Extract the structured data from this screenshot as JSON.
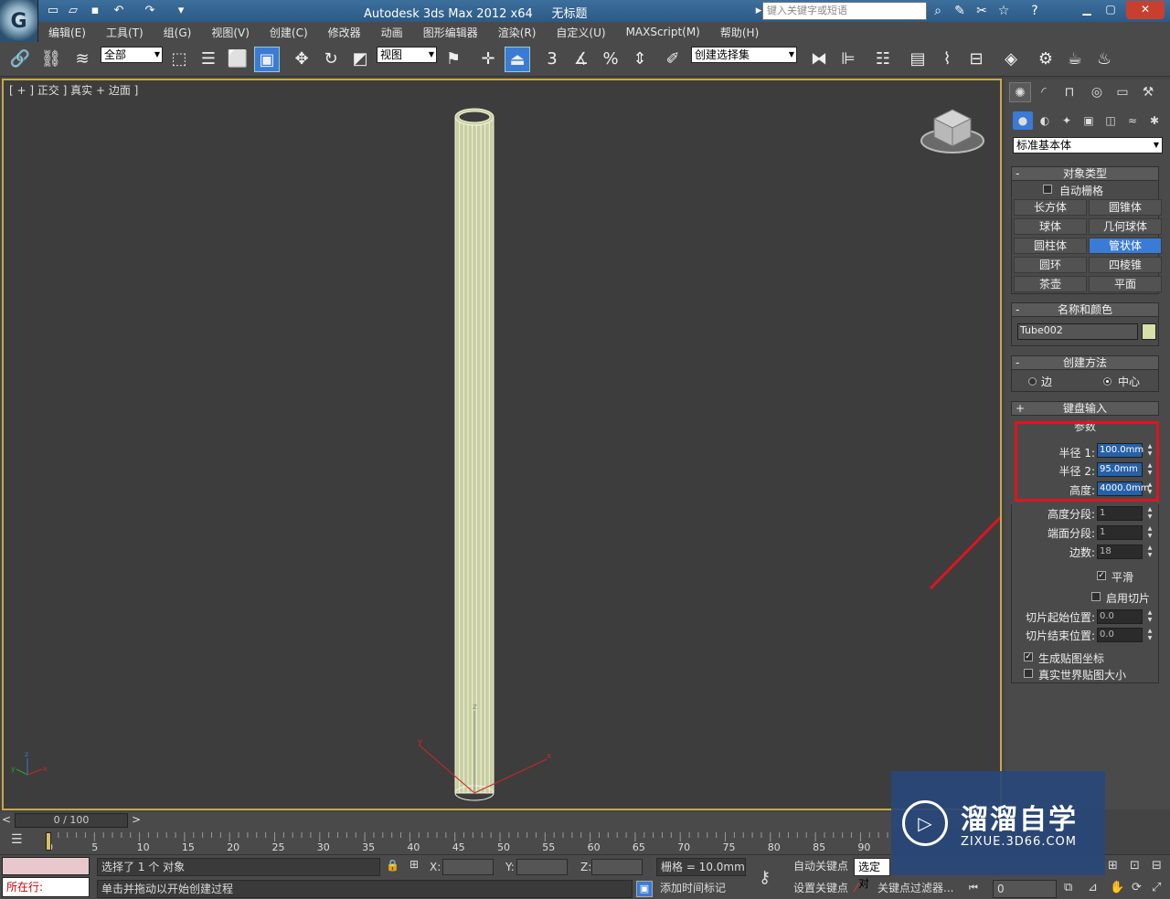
{
  "title_bar": {
    "app_title": "Autodesk 3ds Max  2012 x64",
    "doc_title": "无标题",
    "search_placeholder": "键入关键字或短语"
  },
  "menu": [
    "编辑(E)",
    "工具(T)",
    "组(G)",
    "视图(V)",
    "创建(C)",
    "修改器",
    "动画",
    "图形编辑器",
    "渲染(R)",
    "自定义(U)",
    "MAXScript(M)",
    "帮助(H)"
  ],
  "toolbar": {
    "selection_filter": "全部",
    "ref_coord": "视图",
    "named_selection": "创建选择集",
    "snap_label": "3"
  },
  "viewport": {
    "label": "[ + ] 正交 ] 真实 + 边面 ]",
    "axis_x": "x",
    "axis_y": "y",
    "axis_z": "z"
  },
  "command_panel": {
    "category": "标准基本体",
    "object_type": {
      "header": "对象类型",
      "autogrid": "自动栅格",
      "buttons": [
        "长方体",
        "圆锥体",
        "球体",
        "几何球体",
        "圆柱体",
        "管状体",
        "圆环",
        "四棱锥",
        "茶壶",
        "平面"
      ],
      "active": "管状体"
    },
    "name_color": {
      "header": "名称和颜色",
      "name": "Tube002",
      "color": "#d8e0a8"
    },
    "creation_method": {
      "header": "创建方法",
      "edge": "边",
      "center": "中心"
    },
    "keyboard_entry": {
      "header": "键盘输入"
    },
    "parameters": {
      "header": "参数",
      "radius1_label": "半径 1:",
      "radius1": "100.0mm",
      "radius2_label": "半径 2:",
      "radius2": "95.0mm",
      "height_label": "高度:",
      "height": "4000.0mm",
      "height_segs_label": "高度分段:",
      "height_segs": "1",
      "cap_segs_label": "端面分段:",
      "cap_segs": "1",
      "sides_label": "边数:",
      "sides": "18",
      "smooth": "平滑",
      "slice_on": "启用切片",
      "slice_from_label": "切片起始位置:",
      "slice_from": "0.0",
      "slice_to_label": "切片结束位置:",
      "slice_to": "0.0",
      "gen_mapping": "生成贴图坐标",
      "real_world": "真实世界贴图大小"
    }
  },
  "timeline": {
    "slider": "0 / 100",
    "ticks": [
      "0",
      "5",
      "10",
      "15",
      "20",
      "25",
      "30",
      "35",
      "40",
      "45",
      "50",
      "55",
      "60",
      "65",
      "70",
      "75",
      "80",
      "85",
      "90"
    ]
  },
  "status": {
    "selected": "选择了 1 个 对象",
    "prompt": "单击并拖动以开始创建过程",
    "now_at": "所在行:",
    "x_label": "X:",
    "y_label": "Y:",
    "z_label": "Z:",
    "grid": "栅格 = 10.0mm",
    "auto_key": "自动关键点",
    "set_key": "设置关键点",
    "selected_obj": "选定对",
    "key_filters": "关键点过滤器...",
    "add_time_tag": "添加时间标记",
    "frame": "0"
  },
  "watermark": {
    "title": "溜溜自学",
    "url": "ZIXUE.3D66.COM"
  },
  "colors": {
    "viewport_border": "#c8a84a",
    "active_blue": "#3a7bd5",
    "highlight_red": "#e0141e",
    "object_color": "#d8e0a8"
  }
}
